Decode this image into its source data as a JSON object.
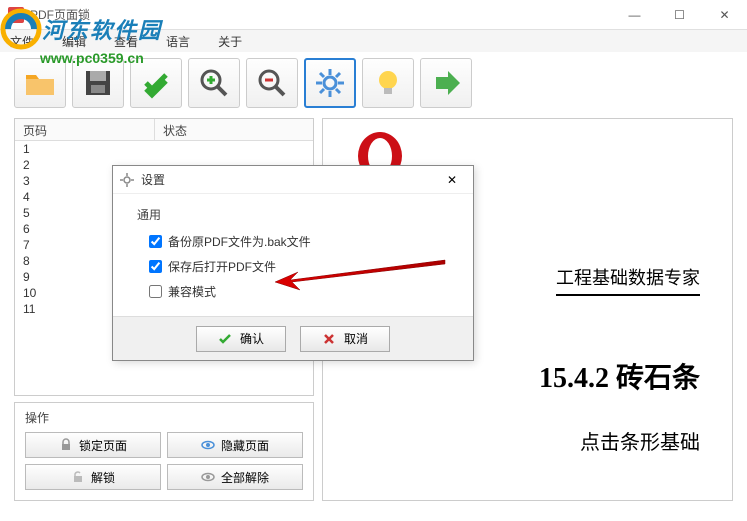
{
  "window": {
    "title": "PDF页面锁",
    "minimize": "—",
    "maximize": "☐",
    "close": "✕"
  },
  "watermark": {
    "brand": "河东软件园",
    "url": "www.pc0359.cn"
  },
  "menu": {
    "file": "文件",
    "edit": "编辑",
    "view": "查看",
    "language": "语言",
    "about": "关于"
  },
  "toolbar": {
    "open": "open-folder-icon",
    "save": "save-icon",
    "apply": "check-icon",
    "zoom_in": "zoom-in-icon",
    "zoom_out": "zoom-out-icon",
    "settings": "gear-icon",
    "tip": "lightbulb-icon",
    "go": "arrow-right-icon"
  },
  "list": {
    "col_page": "页码",
    "col_status": "状态",
    "rows": [
      "1",
      "2",
      "3",
      "4",
      "5",
      "6",
      "7",
      "8",
      "9",
      "10",
      "11"
    ]
  },
  "ops": {
    "title": "操作",
    "lock": "锁定页面",
    "hide": "隐藏页面",
    "unlock": "解锁",
    "unhide_all": "全部解除"
  },
  "preview": {
    "subtitle": "工程基础数据专家",
    "heading": "15.4.2 砖石条",
    "text": "点击条形基础"
  },
  "modal": {
    "title": "设置",
    "group": "通用",
    "opt_backup": "备份原PDF文件为.bak文件",
    "opt_open_after": "保存后打开PDF文件",
    "opt_compat": "兼容模式",
    "ok": "确认",
    "cancel": "取消",
    "close": "✕"
  }
}
